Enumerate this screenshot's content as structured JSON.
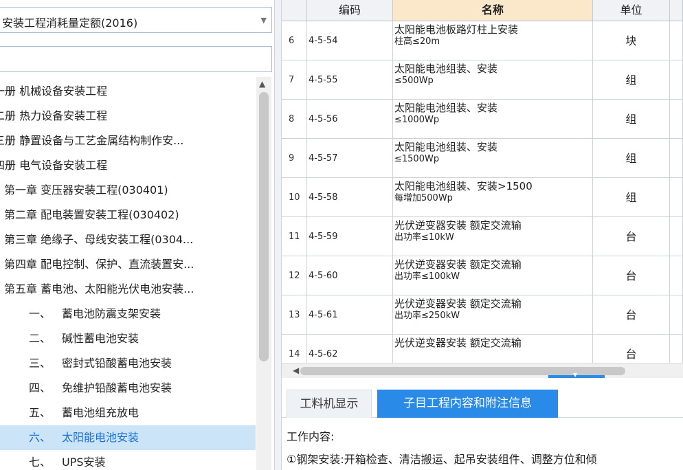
{
  "quota_selector": {
    "value": "安装工程消耗量定额(2016)"
  },
  "search": {
    "value": ""
  },
  "tree": {
    "items": [
      {
        "num": "",
        "text": "一册 机械设备安装工程",
        "level": 0
      },
      {
        "num": "",
        "text": "二册 热力设备安装工程",
        "level": 0
      },
      {
        "num": "",
        "text": "三册 静置设备与工艺金属结构制作安...",
        "level": 0
      },
      {
        "num": "",
        "text": "四册 电气设备安装工程",
        "level": 0
      },
      {
        "num": "",
        "text": "第一章 变压器安装工程(030401)",
        "level": 1
      },
      {
        "num": "",
        "text": "第二章 配电装置安装工程(030402)",
        "level": 1
      },
      {
        "num": "",
        "text": "第三章 绝缘子、母线安装工程(0304...",
        "level": 1
      },
      {
        "num": "",
        "text": "第四章 配电控制、保护、直流装置安...",
        "level": 1
      },
      {
        "num": "",
        "text": "第五章 蓄电池、太阳能光伏电池安装...",
        "level": 1
      },
      {
        "num": "一、",
        "text": "蓄电池防震支架安装",
        "level": 2
      },
      {
        "num": "二、",
        "text": "碱性蓄电池安装",
        "level": 2
      },
      {
        "num": "三、",
        "text": "密封式铅酸蓄电池安装",
        "level": 2
      },
      {
        "num": "四、",
        "text": "免维护铅酸蓄电池安装",
        "level": 2
      },
      {
        "num": "五、",
        "text": "蓄电池组充放电",
        "level": 2
      },
      {
        "num": "六、",
        "text": "太阳能电池安装",
        "level": 2,
        "selected": true
      },
      {
        "num": "七、",
        "text": "UPS安装",
        "level": 2
      }
    ]
  },
  "grid": {
    "headers": {
      "code": "编码",
      "name": "名称",
      "unit": "单位"
    },
    "rows": [
      {
        "n": "6",
        "code": "4-5-54",
        "name1": "太阳能电池板路灯柱上安装",
        "name2": "柱高≤20m",
        "unit": "块"
      },
      {
        "n": "7",
        "code": "4-5-55",
        "name1": "太阳能电池组装、安装",
        "name2": "≤500Wp",
        "unit": "组"
      },
      {
        "n": "8",
        "code": "4-5-56",
        "name1": "太阳能电池组装、安装",
        "name2": "≤1000Wp",
        "unit": "组"
      },
      {
        "n": "9",
        "code": "4-5-57",
        "name1": "太阳能电池组装、安装",
        "name2": "≤1500Wp",
        "unit": "组"
      },
      {
        "n": "10",
        "code": "4-5-58",
        "name1": "太阳能电池组装、安装>1500",
        "name2": "每增加500Wp",
        "unit": "组"
      },
      {
        "n": "11",
        "code": "4-5-59",
        "name1": "光伏逆变器安装 额定交流输",
        "name2": "出功率≤10kW",
        "unit": "台"
      },
      {
        "n": "12",
        "code": "4-5-60",
        "name1": "光伏逆变器安装 额定交流输",
        "name2": "出功率≤100kW",
        "unit": "台"
      },
      {
        "n": "13",
        "code": "4-5-61",
        "name1": "光伏逆变器安装 额定交流输",
        "name2": "出功率≤250kW",
        "unit": "台"
      },
      {
        "n": "14",
        "code": "4-5-62",
        "name1": "光伏逆变器安装 额定交流输",
        "name2": "",
        "unit": "台"
      }
    ]
  },
  "tabs": {
    "materials": "工料机显示",
    "content_info": "子目工程内容和附注信息"
  },
  "info": {
    "title": "工作内容:",
    "content": "①钢架安装:开箱检查、清洁搬运、起吊安装组件、调整方位和倾"
  }
}
